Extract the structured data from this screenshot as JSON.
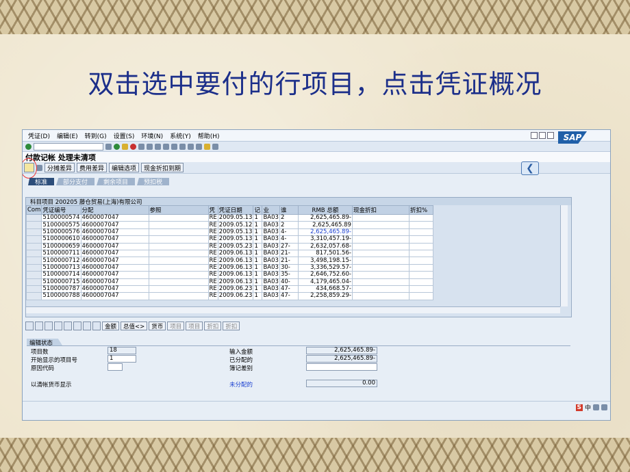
{
  "slide": {
    "title": "双击选中要付的行项目，点击凭证概况"
  },
  "menu": [
    "凭证(D)",
    "编辑(E)",
    "转到(G)",
    "设置(S)",
    "环境(N)",
    "系统(Y)",
    "帮助(H)"
  ],
  "logo": "SAP",
  "screen_title": "付款记帐 处理未清项",
  "app_buttons": [
    "分摊差异",
    "费用差异",
    "编辑选项",
    "现金折扣到期"
  ],
  "tabs": [
    "标准",
    "部分支付",
    "剩余项目",
    "预扣税"
  ],
  "group_title": "科目项目 200205 藤仓贸易(上海)有限公司",
  "columns": [
    "Com",
    "凭证编号",
    "分配",
    "参照",
    "凭",
    "凭证日期",
    "记",
    "业",
    "谁",
    "RMB 总额",
    "现金折扣",
    "折扣%"
  ],
  "rows": [
    {
      "doc": "5100000574",
      "alloc": "4600007047",
      "type": "RE",
      "date": "2009.05.13",
      "pk": "1",
      "ba": "BA03",
      "days": "2",
      "amount": "2,625,465.89-"
    },
    {
      "doc": "5100000575",
      "alloc": "4600007047",
      "type": "RE",
      "date": "2009.05.12",
      "pk": "1",
      "ba": "BA03",
      "days": "2",
      "amount": "2,625,465.89"
    },
    {
      "doc": "5100000576",
      "alloc": "4600007047",
      "type": "RE",
      "date": "2009.05.13",
      "pk": "1",
      "ba": "BA03",
      "days": "4-",
      "amount": "2,625,465.89-"
    },
    {
      "doc": "5100000610",
      "alloc": "4600007047",
      "type": "RE",
      "date": "2009.05.13",
      "pk": "1",
      "ba": "BA03",
      "days": "4-",
      "amount": "3,310,457.19-"
    },
    {
      "doc": "5100000659",
      "alloc": "4600007047",
      "type": "RE",
      "date": "2009.05.23",
      "pk": "1",
      "ba": "BA03",
      "days": "27-",
      "amount": "2,632,057.68-"
    },
    {
      "doc": "5100000711",
      "alloc": "4600007047",
      "type": "RE",
      "date": "2009.06.13",
      "pk": "1",
      "ba": "BA03",
      "days": "21-",
      "amount": "817,501.56-"
    },
    {
      "doc": "5100000712",
      "alloc": "4600007047",
      "type": "RE",
      "date": "2009.06.13",
      "pk": "1",
      "ba": "BA03",
      "days": "21-",
      "amount": "3,498,198.15-"
    },
    {
      "doc": "5100000713",
      "alloc": "4600007047",
      "type": "RE",
      "date": "2009.06.13",
      "pk": "1",
      "ba": "BA03",
      "days": "30-",
      "amount": "3,336,529.57-"
    },
    {
      "doc": "5100000714",
      "alloc": "4600007047",
      "type": "RE",
      "date": "2009.06.13",
      "pk": "1",
      "ba": "BA03",
      "days": "35-",
      "amount": "2,646,752.60-"
    },
    {
      "doc": "5100000715",
      "alloc": "4600007047",
      "type": "RE",
      "date": "2009.06.13",
      "pk": "1",
      "ba": "BA03",
      "days": "40-",
      "amount": "4,179,465.04-"
    },
    {
      "doc": "5100000787",
      "alloc": "4600007047",
      "type": "RE",
      "date": "2009.06.23",
      "pk": "1",
      "ba": "BA03",
      "days": "47-",
      "amount": "434,668.57-"
    },
    {
      "doc": "5100000788",
      "alloc": "4600007047",
      "type": "RE",
      "date": "2009.06.23",
      "pk": "1",
      "ba": "BA03",
      "days": "47-",
      "amount": "2,258,859.29-"
    }
  ],
  "bottom_buttons": [
    "金额",
    "总值<>",
    "货币",
    "项目",
    "项目",
    "折扣",
    "折扣"
  ],
  "status": {
    "title": "编辑状态",
    "item_count_label": "项目数",
    "item_count": "18",
    "first_item_label": "开始显示的项目号",
    "first_item": "1",
    "reason_label": "原因代码",
    "reason": "",
    "local_currency_label": "以清帐货币显示",
    "entered_label": "输入金额",
    "entered": "2,625,465.89-",
    "assigned_label": "已分配的",
    "assigned": "2,625,465.89-",
    "difference_label": "簿记差别",
    "difference": "",
    "unassigned_label": "未分配的",
    "unassigned": "0.00"
  },
  "ime": [
    "S",
    "中"
  ]
}
